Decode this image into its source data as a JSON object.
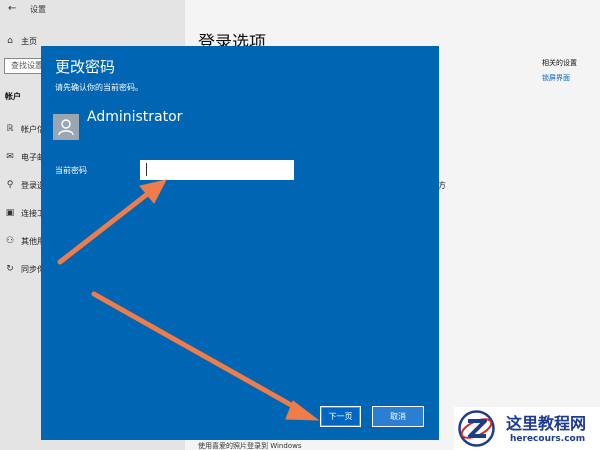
{
  "window": {
    "title": "设置"
  },
  "nav": {
    "home": "主页",
    "search_placeholder": "查找设置",
    "section": "帐户",
    "items": [
      {
        "label": "帐户信息",
        "icon": "person-card-icon"
      },
      {
        "label": "电子邮件和帐户",
        "icon": "mail-icon"
      },
      {
        "label": "登录选项",
        "icon": "key-icon"
      },
      {
        "label": "连接工作或学校帐户",
        "icon": "briefcase-icon"
      },
      {
        "label": "其他用户",
        "icon": "person-add-icon"
      },
      {
        "label": "同步你的设置",
        "icon": "sync-icon"
      }
    ]
  },
  "main": {
    "heading": "登录选项",
    "related_title": "相关的设置",
    "related_link": "锁屏界面",
    "peek_text": "方",
    "bottom_text": "使用喜爱的照片登录到 Windows"
  },
  "dialog": {
    "title": "更改密码",
    "subtitle": "请先确认你的当前密码。",
    "username": "Administrator",
    "field_label": "当前密码",
    "field_value": "",
    "next_label": "下一页",
    "cancel_label": "取消"
  },
  "colors": {
    "dialog_bg": "#0065b3",
    "arrow": "#ef7d4a",
    "link": "#0067c0"
  },
  "logo": {
    "cn": "这里教程网",
    "en": "herecours.com"
  }
}
